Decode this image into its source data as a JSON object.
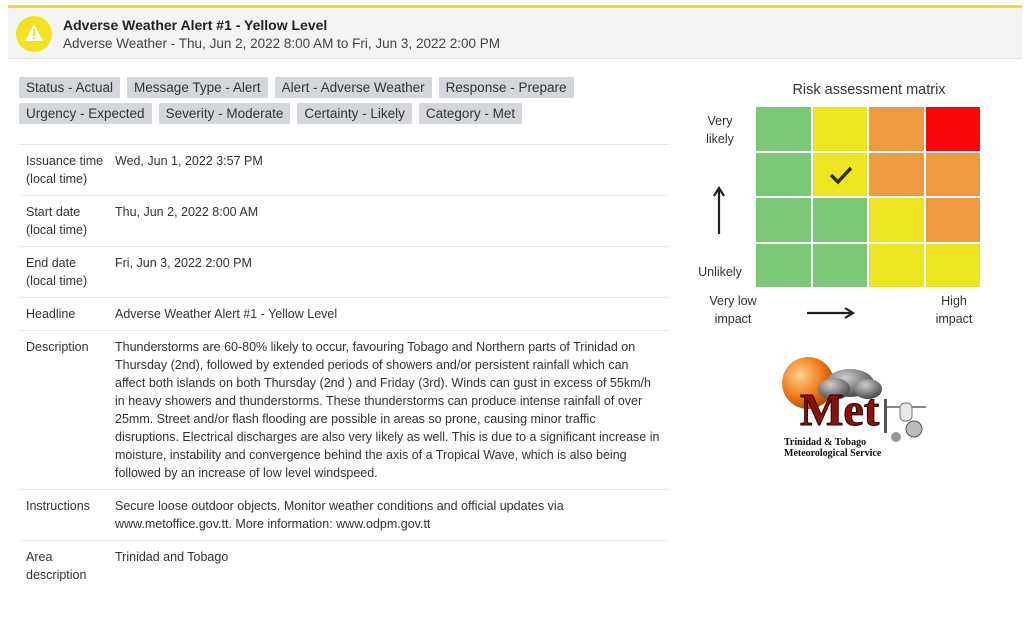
{
  "header": {
    "title": "Adverse Weather Alert #1 - Yellow Level",
    "subtitle": "Adverse Weather - Thu, Jun 2, 2022 8:00 AM to Fri, Jun 3, 2022 2:00 PM",
    "icon": "warning-icon",
    "accent_color": "#ecdd2a"
  },
  "badges": {
    "row1": [
      "Status - Actual",
      "Message Type - Alert",
      "Alert - Adverse Weather",
      "Response - Prepare"
    ],
    "row2": [
      "Urgency - Expected",
      "Severity - Moderate",
      "Certainty - Likely",
      "Category - Met"
    ]
  },
  "details": [
    {
      "label": "Issuance time (local time)",
      "value": "Wed, Jun 1, 2022 3:57 PM"
    },
    {
      "label": "Start date (local time)",
      "value": "Thu, Jun 2, 2022 8:00 AM"
    },
    {
      "label": "End date (local time)",
      "value": "Fri, Jun 3, 2022 2:00 PM"
    },
    {
      "label": "Headline",
      "value": "Adverse Weather Alert #1 - Yellow Level"
    },
    {
      "label": "Description",
      "value": "Thunderstorms are 60-80% likely to occur, favouring Tobago and Northern parts of Trinidad on Thursday (2nd), followed by extended periods of showers and/or persistent rainfall which can affect both islands on both Thursday (2nd ) and Friday (3rd). Winds can gust in excess of 55km/h in heavy showers and thunderstorms. These thunderstorms can produce intense rainfall of over 25mm. Street and/or flash flooding are possible in areas so prone, causing minor traffic disruptions. Electrical discharges are also very likely as well. This is due to a significant increase in moisture, instability and convergence behind the axis of a Tropical Wave, which is also being followed by an increase of low level windspeed."
    },
    {
      "label": "Instructions",
      "value": "Secure loose outdoor objects. Monitor weather conditions and official updates via www.metoffice.gov.tt. More information: www.odpm.gov.tt"
    },
    {
      "label": "Area description",
      "value": "Trinidad and Tobago"
    }
  ],
  "matrix": {
    "title": "Risk assessment matrix",
    "y_top_label": "Very likely",
    "y_bottom_label": "Unlikely",
    "x_left_label": "Very low impact",
    "x_right_label": "High impact",
    "colors": {
      "green": "#79c777",
      "yellow": "#ede422",
      "orange": "#ed9a40",
      "red": "#f90606"
    },
    "rows": [
      [
        "green",
        "yellow",
        "orange",
        "red"
      ],
      [
        "green",
        "yellow",
        "orange",
        "orange"
      ],
      [
        "green",
        "green",
        "yellow",
        "orange"
      ],
      [
        "green",
        "green",
        "yellow",
        "yellow"
      ]
    ],
    "selected": {
      "row": 1,
      "col": 1
    }
  },
  "logo": {
    "text": "Met",
    "line1": "Trinidad & Tobago",
    "line2": "Meteorological Service"
  }
}
